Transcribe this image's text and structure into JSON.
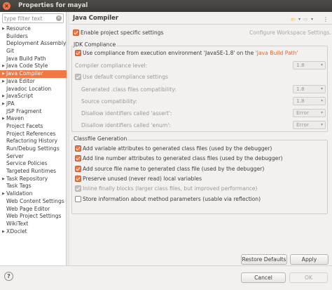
{
  "window": {
    "title": "Properties for mayal",
    "close_glyph": "×"
  },
  "filter": {
    "placeholder": "type filter text",
    "value": "",
    "clear_glyph": "×"
  },
  "tree": [
    {
      "label": "Resource",
      "arrow": true
    },
    {
      "label": "Builders",
      "arrow": false
    },
    {
      "label": "Deployment Assembly",
      "arrow": false
    },
    {
      "label": "Git",
      "arrow": false
    },
    {
      "label": "Java Build Path",
      "arrow": false
    },
    {
      "label": "Java Code Style",
      "arrow": true
    },
    {
      "label": "Java Compiler",
      "arrow": true,
      "selected": true
    },
    {
      "label": "Java Editor",
      "arrow": true
    },
    {
      "label": "Javadoc Location",
      "arrow": false
    },
    {
      "label": "JavaScript",
      "arrow": true
    },
    {
      "label": "JPA",
      "arrow": true
    },
    {
      "label": "JSP Fragment",
      "arrow": false
    },
    {
      "label": "Maven",
      "arrow": true
    },
    {
      "label": "Project Facets",
      "arrow": false
    },
    {
      "label": "Project References",
      "arrow": false
    },
    {
      "label": "Refactoring History",
      "arrow": false
    },
    {
      "label": "Run/Debug Settings",
      "arrow": false
    },
    {
      "label": "Server",
      "arrow": false
    },
    {
      "label": "Service Policies",
      "arrow": false
    },
    {
      "label": "Targeted Runtimes",
      "arrow": false
    },
    {
      "label": "Task Repository",
      "arrow": true
    },
    {
      "label": "Task Tags",
      "arrow": false
    },
    {
      "label": "Validation",
      "arrow": true
    },
    {
      "label": "Web Content Settings",
      "arrow": false
    },
    {
      "label": "Web Page Editor",
      "arrow": false
    },
    {
      "label": "Web Project Settings",
      "arrow": false
    },
    {
      "label": "WikiText",
      "arrow": false
    },
    {
      "label": "XDoclet",
      "arrow": true
    }
  ],
  "tree_arrow_glyph": "▶",
  "page": {
    "title": "Java Compiler",
    "nav_back": "⇦",
    "nav_back_menu": "▾",
    "nav_forward": "⇨",
    "nav_forward_menu": "▾",
    "nav_menu": "⋮",
    "enable_specific": {
      "label": "Enable project specific settings",
      "checked": true
    },
    "configure_link": "Configure Workspace Settings..."
  },
  "jdk": {
    "group_title": "JDK Compliance",
    "use_compliance": {
      "label_prefix": "Use compliance from execution environment 'JavaSE-1.8' on the ",
      "link": "'Java Build Path'",
      "checked": true
    },
    "compliance_level": {
      "label": "Compiler compliance level:",
      "value": "1.8"
    },
    "use_default": {
      "label": "Use default compliance settings",
      "checked": true
    },
    "generated_class": {
      "label": "Generated .class files compatibility:",
      "value": "1.8"
    },
    "source_compat": {
      "label": "Source compatibility:",
      "value": "1.8"
    },
    "disallow_assert": {
      "label": "Disallow identifiers called 'assert':",
      "value": "Error"
    },
    "disallow_enum": {
      "label": "Disallow identifiers called 'enum':",
      "value": "Error"
    },
    "caret": "▾"
  },
  "classfile": {
    "group_title": "Classfile Generation",
    "items": [
      {
        "label": "Add variable attributes to generated class files (used by the debugger)",
        "checked": true,
        "disabled": false
      },
      {
        "label": "Add line number attributes to generated class files (used by the debugger)",
        "checked": true,
        "disabled": false
      },
      {
        "label": "Add source file name to generated class file (used by the debugger)",
        "checked": true,
        "disabled": false
      },
      {
        "label": "Preserve unused (never read) local variables",
        "checked": true,
        "disabled": false
      },
      {
        "label": "Inline finally blocks (larger class files, but improved performance)",
        "checked": true,
        "disabled": true
      },
      {
        "label": "Store information about method parameters (usable via reflection)",
        "checked": false,
        "disabled": false
      }
    ]
  },
  "buttons": {
    "restore_defaults": "Restore Defaults",
    "apply": "Apply",
    "cancel": "Cancel",
    "ok": "OK"
  },
  "help_glyph": "?",
  "colors": {
    "accent": "#f07746",
    "link": "#e36a2e",
    "titlebar": "#3c3b37"
  }
}
